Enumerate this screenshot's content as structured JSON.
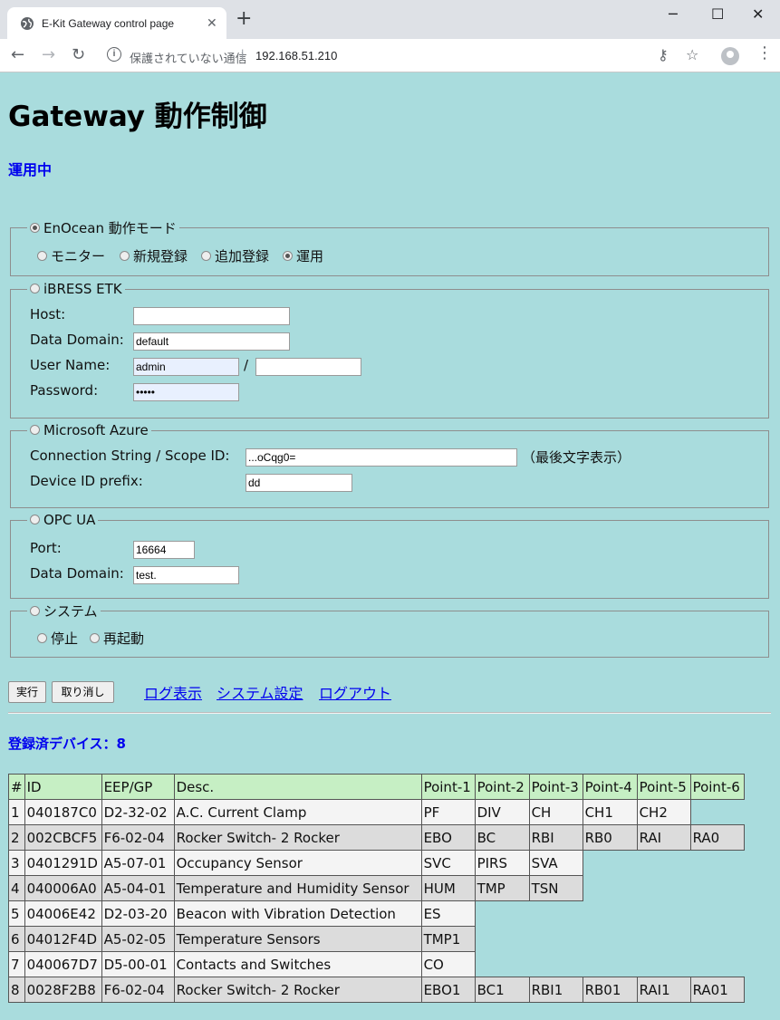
{
  "browser": {
    "tab_title": "E-Kit Gateway control page",
    "insecure_label": "保護されていない通信",
    "url": "192.168.51.210"
  },
  "page": {
    "title": "Gateway 動作制御",
    "status": "運用中"
  },
  "enocean": {
    "legend": "EnOcean 動作モード",
    "selected": true,
    "options": [
      {
        "label": "モニター",
        "checked": false
      },
      {
        "label": "新規登録",
        "checked": false
      },
      {
        "label": "追加登録",
        "checked": false
      },
      {
        "label": "運用",
        "checked": true
      }
    ]
  },
  "ibress": {
    "legend": "iBRESS ETK",
    "host_label": "Host:",
    "host_value": "",
    "domain_label": "Data Domain:",
    "domain_value": "default",
    "user_label": "User Name:",
    "user_value": "admin",
    "user_sep": "/",
    "user_value2": "",
    "password_label": "Password:",
    "password_value": "•••••"
  },
  "azure": {
    "legend": "Microsoft Azure",
    "conn_label": "Connection String / Scope ID:",
    "conn_value": "...oCqg0=",
    "conn_note": "（最後文字表示）",
    "device_label": "Device ID prefix:",
    "device_value": "dd"
  },
  "opcua": {
    "legend": "OPC UA",
    "port_label": "Port:",
    "port_value": "16664",
    "domain_label": "Data Domain:",
    "domain_value": "test."
  },
  "system": {
    "legend": "システム",
    "options": [
      {
        "label": "停止",
        "checked": false
      },
      {
        "label": "再起動",
        "checked": false
      }
    ]
  },
  "actions": {
    "execute": "実行",
    "cancel": "取り消し",
    "links": [
      "ログ表示",
      "システム設定",
      "ログアウト"
    ]
  },
  "devices": {
    "heading": "登録済デバイス：8",
    "columns": [
      "#",
      "ID",
      "EEP/GP",
      "Desc.",
      "Point-1",
      "Point-2",
      "Point-3",
      "Point-4",
      "Point-5",
      "Point-6"
    ],
    "rows": [
      [
        "1",
        "040187C0",
        "D2-32-02",
        "A.C. Current Clamp",
        "PF",
        "DIV",
        "CH",
        "CH1",
        "CH2"
      ],
      [
        "2",
        "002CBCF5",
        "F6-02-04",
        "Rocker Switch- 2 Rocker",
        "EBO",
        "BC",
        "RBI",
        "RB0",
        "RAI",
        "RA0"
      ],
      [
        "3",
        "0401291D",
        "A5-07-01",
        "Occupancy Sensor",
        "SVC",
        "PIRS",
        "SVA"
      ],
      [
        "4",
        "040006A0",
        "A5-04-01",
        "Temperature and Humidity Sensor",
        "HUM",
        "TMP",
        "TSN"
      ],
      [
        "5",
        "04006E42",
        "D2-03-20",
        "Beacon with Vibration Detection",
        "ES"
      ],
      [
        "6",
        "04012F4D",
        "A5-02-05",
        "Temperature Sensors",
        "TMP1"
      ],
      [
        "7",
        "040067D7",
        "D5-00-01",
        "Contacts and Switches",
        "CO"
      ],
      [
        "8",
        "0028F2B8",
        "F6-02-04",
        "Rocker Switch- 2 Rocker",
        "EBO1",
        "BC1",
        "RBI1",
        "RB01",
        "RAI1",
        "RA01"
      ]
    ]
  }
}
